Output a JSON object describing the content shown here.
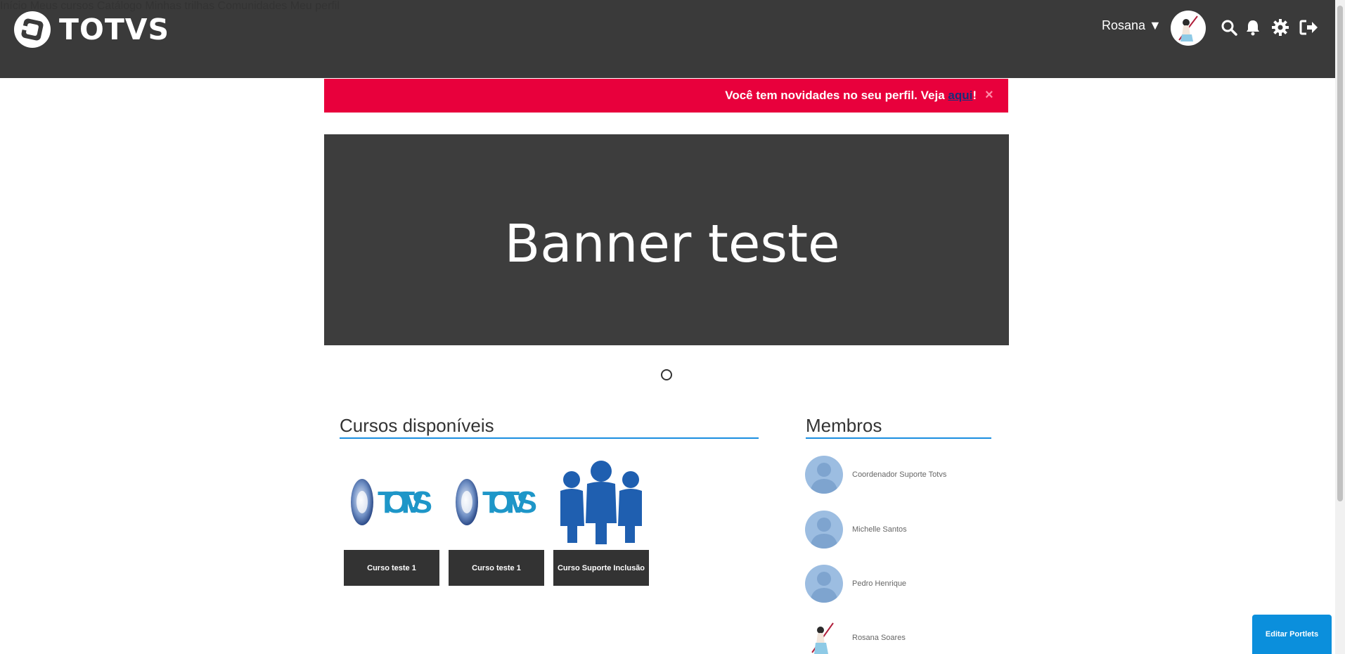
{
  "header": {
    "logo_text": "TOTVS",
    "user_name": "Rosana ▼",
    "nav": [
      {
        "label": "Início"
      },
      {
        "label": "Meus cursos"
      },
      {
        "label": "Catálogo"
      },
      {
        "label": "Minhas trilhas"
      },
      {
        "label": "Comunidades"
      },
      {
        "label": "Meu perfil"
      }
    ],
    "icons": [
      "search-icon",
      "bell-icon",
      "gear-icon",
      "logout-icon"
    ]
  },
  "notice": {
    "text_before": "Você tem novidades no seu perfil. Veja ",
    "link": "aqui",
    "text_after": "!",
    "close": "×"
  },
  "banner": {
    "title": "Banner teste"
  },
  "courses": {
    "title": "Cursos disponíveis",
    "items": [
      {
        "label": "Curso teste 1",
        "image": "totvs-logo"
      },
      {
        "label": "Curso teste 1",
        "image": "totvs-logo"
      },
      {
        "label": "Curso Suporte Inclusão",
        "image": "people-group"
      }
    ]
  },
  "members": {
    "title": "Membros",
    "items": [
      {
        "name": "Coordenador Suporte Totvs"
      },
      {
        "name": "Michelle Santos"
      },
      {
        "name": "Pedro Henrique"
      },
      {
        "name": "Rosana Soares"
      }
    ]
  },
  "edit_button": "Editar Portlets",
  "colors": {
    "header_bg": "#3a3a3a",
    "notice_bg": "#e8003c",
    "banner_bg": "#3d3d3d",
    "accent": "#1a8ee0",
    "course_button_bg": "#333333",
    "edit_button_bg": "#0b8fdc"
  }
}
